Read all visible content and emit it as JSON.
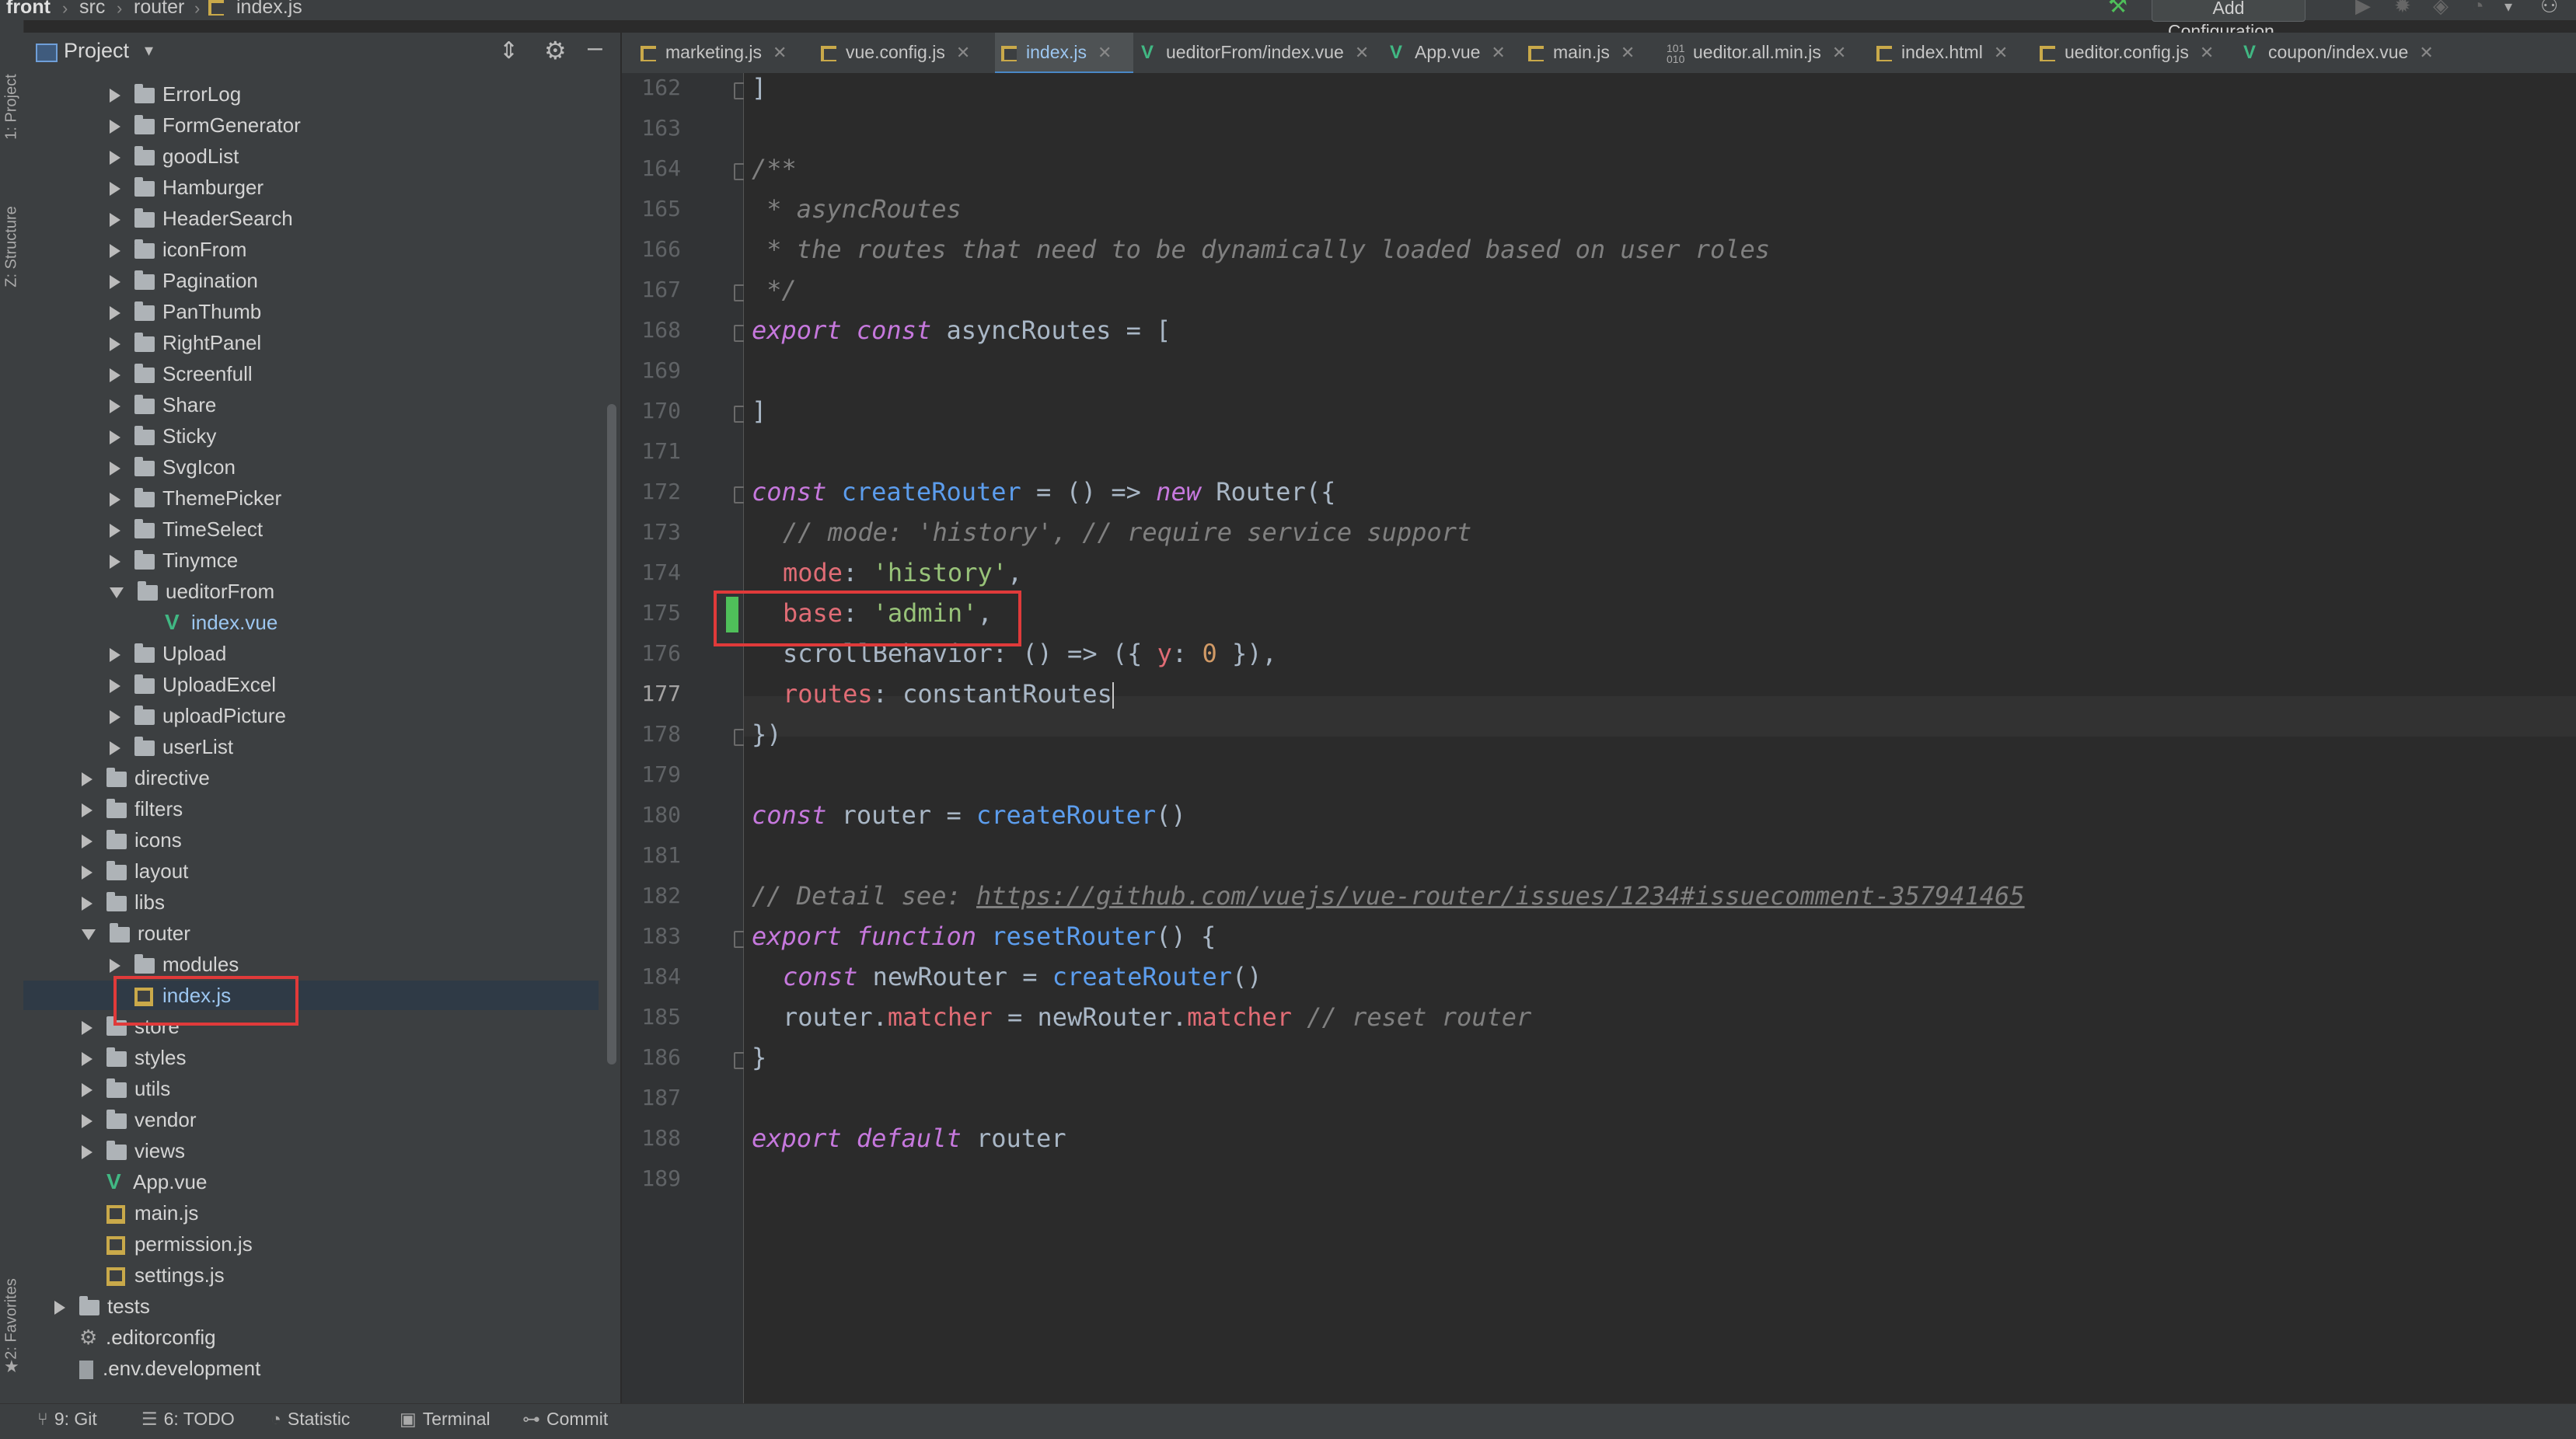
{
  "breadcrumb": [
    "front",
    "src",
    "router",
    "index.js"
  ],
  "toolbar": {
    "add_configuration": "Add Configuration..."
  },
  "toolstrip": {
    "project": "1: Project",
    "structure": "Z: Structure",
    "favorites": "2: Favorites"
  },
  "project_panel": {
    "title": "Project"
  },
  "tree": [
    {
      "label": "ErrorLog",
      "type": "folder",
      "depth": 2,
      "expanded": false
    },
    {
      "label": "FormGenerator",
      "type": "folder",
      "depth": 2,
      "expanded": false
    },
    {
      "label": "goodList",
      "type": "folder",
      "depth": 2,
      "expanded": false
    },
    {
      "label": "Hamburger",
      "type": "folder",
      "depth": 2,
      "expanded": false
    },
    {
      "label": "HeaderSearch",
      "type": "folder",
      "depth": 2,
      "expanded": false
    },
    {
      "label": "iconFrom",
      "type": "folder",
      "depth": 2,
      "expanded": false
    },
    {
      "label": "Pagination",
      "type": "folder",
      "depth": 2,
      "expanded": false
    },
    {
      "label": "PanThumb",
      "type": "folder",
      "depth": 2,
      "expanded": false
    },
    {
      "label": "RightPanel",
      "type": "folder",
      "depth": 2,
      "expanded": false
    },
    {
      "label": "Screenfull",
      "type": "folder",
      "depth": 2,
      "expanded": false
    },
    {
      "label": "Share",
      "type": "folder",
      "depth": 2,
      "expanded": false
    },
    {
      "label": "Sticky",
      "type": "folder",
      "depth": 2,
      "expanded": false
    },
    {
      "label": "SvgIcon",
      "type": "folder",
      "depth": 2,
      "expanded": false
    },
    {
      "label": "ThemePicker",
      "type": "folder",
      "depth": 2,
      "expanded": false
    },
    {
      "label": "TimeSelect",
      "type": "folder",
      "depth": 2,
      "expanded": false
    },
    {
      "label": "Tinymce",
      "type": "folder",
      "depth": 2,
      "expanded": false
    },
    {
      "label": "ueditorFrom",
      "type": "folder",
      "depth": 2,
      "expanded": true
    },
    {
      "label": "index.vue",
      "type": "vue",
      "depth": 3
    },
    {
      "label": "Upload",
      "type": "folder",
      "depth": 2,
      "expanded": false
    },
    {
      "label": "UploadExcel",
      "type": "folder",
      "depth": 2,
      "expanded": false
    },
    {
      "label": "uploadPicture",
      "type": "folder",
      "depth": 2,
      "expanded": false
    },
    {
      "label": "userList",
      "type": "folder",
      "depth": 2,
      "expanded": false
    },
    {
      "label": "directive",
      "type": "folder",
      "depth": 1,
      "expanded": false
    },
    {
      "label": "filters",
      "type": "folder",
      "depth": 1,
      "expanded": false
    },
    {
      "label": "icons",
      "type": "folder",
      "depth": 1,
      "expanded": false
    },
    {
      "label": "layout",
      "type": "folder",
      "depth": 1,
      "expanded": false
    },
    {
      "label": "libs",
      "type": "folder",
      "depth": 1,
      "expanded": false
    },
    {
      "label": "router",
      "type": "folder",
      "depth": 1,
      "expanded": true
    },
    {
      "label": "modules",
      "type": "folder",
      "depth": 2,
      "expanded": false
    },
    {
      "label": "index.js",
      "type": "js",
      "depth": 2,
      "selected": true
    },
    {
      "label": "store",
      "type": "folder",
      "depth": 1,
      "expanded": false
    },
    {
      "label": "styles",
      "type": "folder",
      "depth": 1,
      "expanded": false
    },
    {
      "label": "utils",
      "type": "folder",
      "depth": 1,
      "expanded": false
    },
    {
      "label": "vendor",
      "type": "folder",
      "depth": 1,
      "expanded": false
    },
    {
      "label": "views",
      "type": "folder",
      "depth": 1,
      "expanded": false
    },
    {
      "label": "App.vue",
      "type": "vue",
      "depth": 1
    },
    {
      "label": "main.js",
      "type": "js",
      "depth": 1
    },
    {
      "label": "permission.js",
      "type": "js",
      "depth": 1
    },
    {
      "label": "settings.js",
      "type": "js",
      "depth": 1
    },
    {
      "label": "tests",
      "type": "folder",
      "depth": 0,
      "expanded": false
    },
    {
      "label": ".editorconfig",
      "type": "config",
      "depth": 0
    },
    {
      "label": ".env.development",
      "type": "file",
      "depth": 0
    }
  ],
  "tabs": [
    {
      "label": "marketing.js",
      "icon": "js"
    },
    {
      "label": "vue.config.js",
      "icon": "js"
    },
    {
      "label": "index.js",
      "icon": "js",
      "active": true
    },
    {
      "label": "ueditorFrom/index.vue",
      "icon": "vue"
    },
    {
      "label": "App.vue",
      "icon": "vue"
    },
    {
      "label": "main.js",
      "icon": "js"
    },
    {
      "label": "ueditor.all.min.js",
      "icon": "bin"
    },
    {
      "label": "index.html",
      "icon": "js"
    },
    {
      "label": "ueditor.config.js",
      "icon": "js"
    },
    {
      "label": "coupon/index.vue",
      "icon": "vue"
    }
  ],
  "code": {
    "line_numbers": [
      "162",
      "163",
      "164",
      "165",
      "166",
      "167",
      "168",
      "169",
      "170",
      "171",
      "172",
      "173",
      "174",
      "175",
      "176",
      "177",
      "178",
      "179",
      "180",
      "181",
      "182",
      "183",
      "184",
      "185",
      "186",
      "187",
      "188",
      "189"
    ],
    "current_line": "177",
    "l162": "]",
    "l164": "/**",
    "l165": " * asyncRoutes",
    "l166": " * the routes that need to be dynamically loaded based on user roles",
    "l167": " */",
    "l168_kw1": "export",
    "l168_kw2": "const",
    "l168_rest": " asyncRoutes = [",
    "l170": "]",
    "l172_kw": "const",
    "l172_fn": "createRouter",
    "l172_mid": " = () => ",
    "l172_new": "new",
    "l172_rest": " Router({",
    "l173": "// mode: 'history', // require service support",
    "l174_prop": "mode",
    "l174_str": "'history'",
    "l175_prop": "base",
    "l175_str": "'admin'",
    "l176_a": "scrollBehavior: () => ({ ",
    "l176_y": "y",
    "l176_b": ": ",
    "l176_num": "0",
    "l176_c": " }),",
    "l177_prop": "routes",
    "l177_val": "constantRoutes",
    "l178": "})",
    "l180_kw": "const",
    "l180_mid": " router = ",
    "l180_fn": "createRouter",
    "l180_rest": "()",
    "l182_cm": "// Detail see: ",
    "l182_link": "https://github.com/vuejs/vue-router/issues/1234#issuecomment-357941465",
    "l183_kw1": "export",
    "l183_kw2": "function",
    "l183_fn": "resetRouter",
    "l183_rest": "() {",
    "l184_kw": "const",
    "l184_mid": " newRouter = ",
    "l184_fn": "createRouter",
    "l184_rest": "()",
    "l185_a": "router.",
    "l185_prop1": "matcher",
    "l185_b": " = newRouter.",
    "l185_prop2": "matcher",
    "l185_cm": " // reset router",
    "l186": "}",
    "l188_kw1": "export",
    "l188_kw2": "default",
    "l188_rest": " router"
  },
  "statusbar": [
    {
      "label": "9: Git"
    },
    {
      "label": "6: TODO"
    },
    {
      "label": "Statistic"
    },
    {
      "label": "Terminal"
    },
    {
      "label": "Commit"
    }
  ],
  "colors": {
    "accent": "#4a88c7",
    "highlight_box": "#e03a3a",
    "change_marker": "#4fbf5a"
  }
}
